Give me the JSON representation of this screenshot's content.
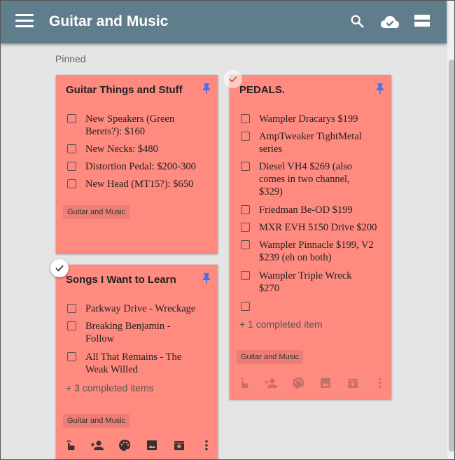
{
  "app": {
    "title": "Guitar and Music",
    "icons": [
      "menu-icon",
      "search-icon",
      "cloud-done-icon",
      "list-view-icon"
    ]
  },
  "section": {
    "pinned_label": "Pinned"
  },
  "colors": {
    "appbar": "#607d8b",
    "note": "#ff8a80",
    "pin": "#3d73f5",
    "background": "#e5e5e5"
  },
  "notes": [
    {
      "title": "Guitar Things and Stuff",
      "items": [
        {
          "text": "New Speakers (Green Berets?): $160",
          "checked": false
        },
        {
          "text": "New Necks: $480",
          "checked": false
        },
        {
          "text": "Distortion Pedal: $200-300",
          "checked": false
        },
        {
          "text": "New Head (MT15?): $650",
          "checked": false
        }
      ],
      "label": "Guitar and Music"
    },
    {
      "title": "Songs I Want to Learn",
      "items": [
        {
          "text": "Parkway Drive - Wreckage",
          "checked": false
        },
        {
          "text": "Breaking Benjamin - Follow",
          "checked": false
        },
        {
          "text": "All That Remains - The Weak Willed",
          "checked": false
        }
      ],
      "completed": "+ 3 completed items",
      "label": "Guitar and Music"
    },
    {
      "title": "PEDALS.",
      "items": [
        {
          "text": "Wampler Dracarys $199",
          "checked": false
        },
        {
          "text": "AmpTweaker TightMetal series",
          "checked": false
        },
        {
          "text": "Diesel VH4 $269 (also comes in two channel, $329)",
          "checked": false
        },
        {
          "text": "Friedman Be-OD $199",
          "checked": false
        },
        {
          "text": "MXR EVH 5150 Drive $200",
          "checked": false
        },
        {
          "text": "Wampler Pinnacle $199, V2 $239 (eh on both)",
          "checked": false
        },
        {
          "text": "Wampler Triple Wreck $270",
          "checked": false
        },
        {
          "text": "",
          "checked": false
        }
      ],
      "completed": "+ 1 completed item",
      "label": "Guitar and Music"
    }
  ],
  "toolbar_icons": [
    "remind-me-icon",
    "collaborator-icon",
    "palette-icon",
    "image-icon",
    "archive-icon",
    "more-icon"
  ]
}
